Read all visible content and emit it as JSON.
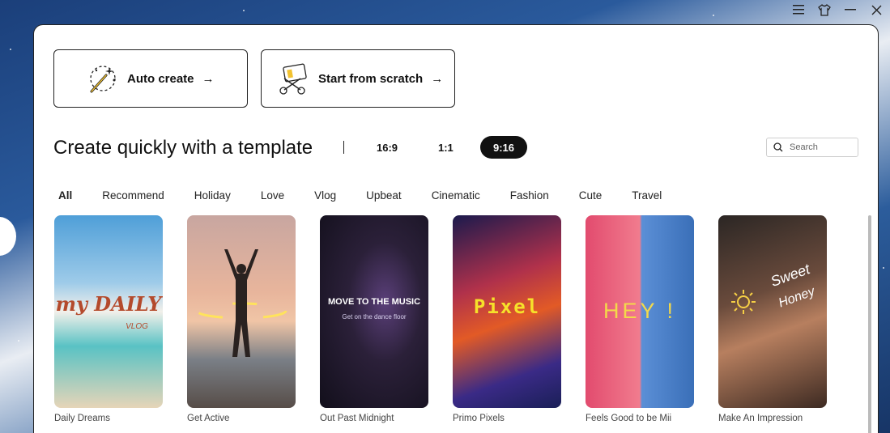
{
  "window": {
    "controls": [
      {
        "name": "menu-icon"
      },
      {
        "name": "shirt-icon"
      },
      {
        "name": "minimize-icon"
      },
      {
        "name": "close-icon"
      }
    ]
  },
  "actions": {
    "auto_create": "Auto create",
    "start_scratch": "Start from scratch",
    "arrow": "→"
  },
  "heading": "Create quickly with a template",
  "ratios": [
    "16:9",
    "1:1",
    "9:16"
  ],
  "active_ratio": "9:16",
  "search": {
    "placeholder": "Search"
  },
  "categories": [
    "All",
    "Recommend",
    "Holiday",
    "Love",
    "Vlog",
    "Upbeat",
    "Cinematic",
    "Fashion",
    "Cute",
    "Travel"
  ],
  "active_category": "All",
  "templates": [
    {
      "title": "Daily Dreams",
      "overlay_main": "my DAILY",
      "overlay_sub": "VLOG"
    },
    {
      "title": "Get Active"
    },
    {
      "title": "Out Past Midnight",
      "overlay_main": "MOVE TO THE MUSIC",
      "overlay_sub": "Get on the dance floor"
    },
    {
      "title": "Primo Pixels",
      "overlay_main": "Pixel"
    },
    {
      "title": "Feels Good to be Mii",
      "overlay_main": "HEY !"
    },
    {
      "title": "Make An Impression",
      "overlay_main": "Sweet",
      "overlay_sub": "Honey"
    }
  ],
  "colors": {
    "accent": "#111111",
    "panel_bg": "#ffffff",
    "pixel_yellow": "#f6e12a",
    "hey_yellow": "#f3d94a"
  }
}
